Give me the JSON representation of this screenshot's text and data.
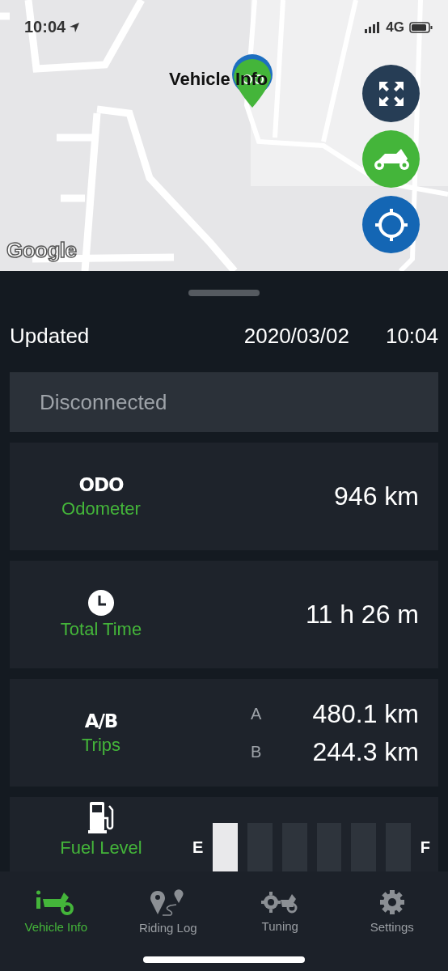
{
  "status_bar": {
    "time": "10:04",
    "network": "4G"
  },
  "map": {
    "marker_label": "Vehicle Info",
    "attribution": "Google",
    "buttons": [
      {
        "kind": "fit"
      },
      {
        "kind": "vehicle"
      },
      {
        "kind": "locate"
      }
    ]
  },
  "updated": {
    "label": "Updated",
    "date": "2020/03/02",
    "time": "10:04"
  },
  "connection": {
    "status": "Disconnected"
  },
  "cards": [
    {
      "kind": "odo",
      "badge": "ODO",
      "label": "Odometer",
      "value": "946 km"
    },
    {
      "kind": "time",
      "label": "Total Time",
      "value": "11 h 26 m"
    },
    {
      "kind": "trips",
      "badge": "A/B",
      "label": "Trips",
      "trips": [
        {
          "name": "A",
          "value": "480.1 km"
        },
        {
          "name": "B",
          "value": "244.3 km"
        }
      ]
    },
    {
      "kind": "fuel",
      "label": "Fuel Level",
      "empty_label": "E",
      "full_label": "F",
      "level": 0.17
    }
  ],
  "tabs": [
    {
      "kind": "vehicle",
      "label": "Vehicle Info",
      "selected": true
    },
    {
      "kind": "log",
      "label": "Riding Log",
      "selected": false
    },
    {
      "kind": "tuning",
      "label": "Tuning",
      "selected": false
    },
    {
      "kind": "settings",
      "label": "Settings",
      "selected": false
    }
  ]
}
